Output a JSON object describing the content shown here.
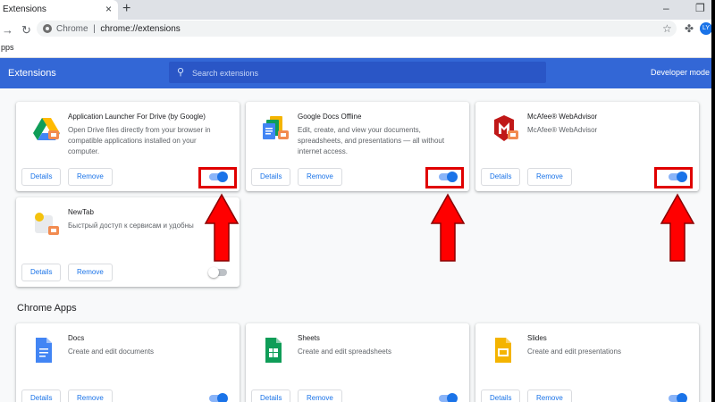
{
  "tab": {
    "title": "Extensions",
    "close_label": "×",
    "newtab_label": "+"
  },
  "window": {
    "minimize_label": "–",
    "restore_label": "❐"
  },
  "nav": {
    "back_icon": "arrow-left-icon",
    "reload_icon": "reload-icon"
  },
  "omnibox": {
    "site_label": "Chrome",
    "separator": "|",
    "url": "chrome://extensions"
  },
  "profile": {
    "initials": "LY"
  },
  "bookmarks": {
    "apps_label": "pps"
  },
  "header": {
    "title": "Extensions",
    "search_placeholder": "Search extensions",
    "developer_mode_label": "Developer mode"
  },
  "buttons": {
    "details": "Details",
    "remove": "Remove"
  },
  "extensions": [
    {
      "name": "Application Launcher For Drive (by Google)",
      "description": "Open Drive files directly from your browser in compatible applications installed on your computer.",
      "icon": "google-drive-icon",
      "enabled": true
    },
    {
      "name": "Google Docs Offline",
      "description": "Edit, create, and view your documents, spreadsheets, and presentations — all without internet access.",
      "icon": "google-docs-offline-icon",
      "enabled": true
    },
    {
      "name": "McAfee® WebAdvisor",
      "description": "McAfee® WebAdvisor",
      "icon": "mcafee-shield-icon",
      "enabled": true
    },
    {
      "name": "NewTab",
      "description": "Быстрый доступ к сервисам и удобны",
      "icon": "newtab-puzzle-icon",
      "enabled": false
    }
  ],
  "apps_section": {
    "heading": "Chrome Apps",
    "apps": [
      {
        "name": "Docs",
        "description": "Create and edit documents",
        "icon": "google-docs-icon",
        "enabled": true
      },
      {
        "name": "Sheets",
        "description": "Create and edit spreadsheets",
        "icon": "google-sheets-icon",
        "enabled": true
      },
      {
        "name": "Slides",
        "description": "Create and edit presentations",
        "icon": "google-slides-icon",
        "enabled": true
      }
    ]
  },
  "colors": {
    "header_blue": "#3367d6",
    "toggle_on": "#1a73e8",
    "highlight_red": "#e00000",
    "docs_blue": "#4285f4",
    "sheets_green": "#0f9d58",
    "slides_yellow": "#f4b400",
    "mcafee_red": "#c01818"
  }
}
